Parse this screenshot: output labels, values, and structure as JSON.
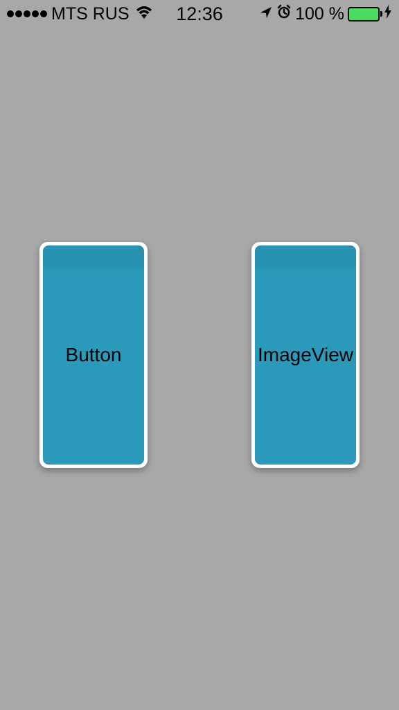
{
  "status_bar": {
    "carrier": "MTS RUS",
    "time": "12:36",
    "battery_percent": "100 %"
  },
  "cards": {
    "left": {
      "label": "Button"
    },
    "right": {
      "label": "ImageView"
    }
  }
}
